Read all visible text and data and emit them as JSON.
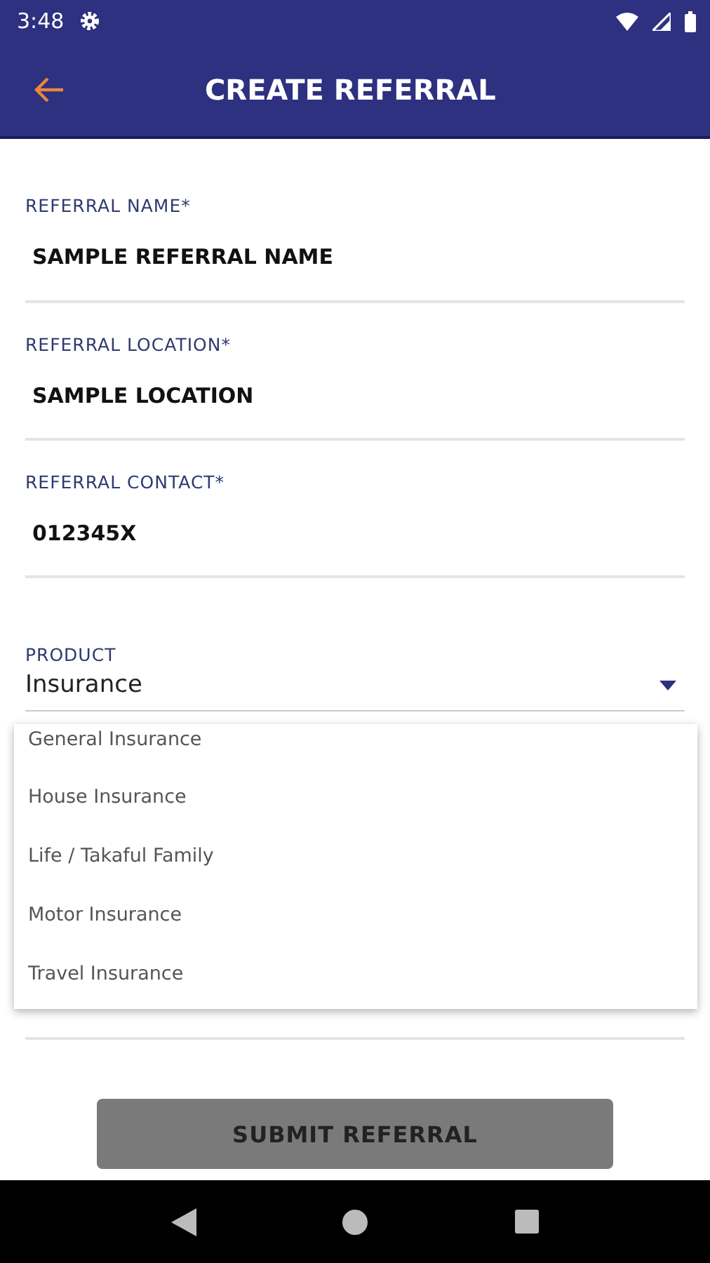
{
  "status_bar": {
    "time": "3:48"
  },
  "app_bar": {
    "title": "CREATE REFERRAL"
  },
  "fields": [
    {
      "label": "REFERRAL NAME*",
      "value": "SAMPLE REFERRAL NAME"
    },
    {
      "label": "REFERRAL LOCATION*",
      "value": "SAMPLE LOCATION"
    },
    {
      "label": "REFERRAL CONTACT*",
      "value": "012345X"
    }
  ],
  "product": {
    "label": "PRODUCT",
    "value": "Insurance",
    "expanded": true
  },
  "product_options": [
    "General Insurance",
    "House Insurance",
    "Life / Takaful Family",
    "Motor Insurance",
    "Travel Insurance"
  ],
  "submit_button": {
    "label": "SUBMIT REFERRAL",
    "disabled": true
  }
}
